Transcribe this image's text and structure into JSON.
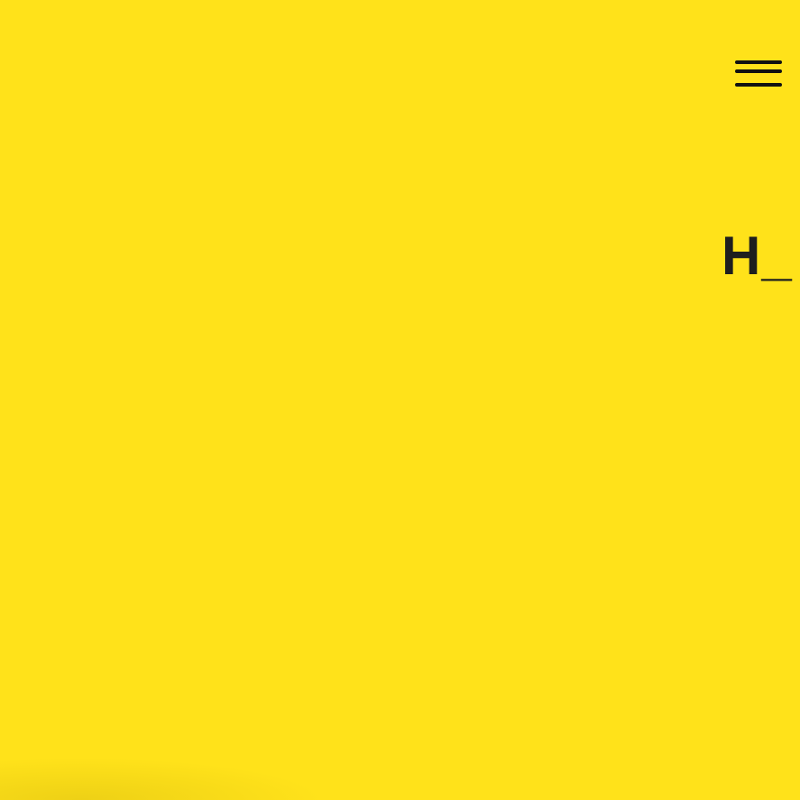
{
  "colors": {
    "background": "#FFE21A",
    "foreground": "#1E1E1E"
  },
  "header": {
    "menu_icon": "hamburger-menu-icon"
  },
  "logo": {
    "text": "H_"
  }
}
